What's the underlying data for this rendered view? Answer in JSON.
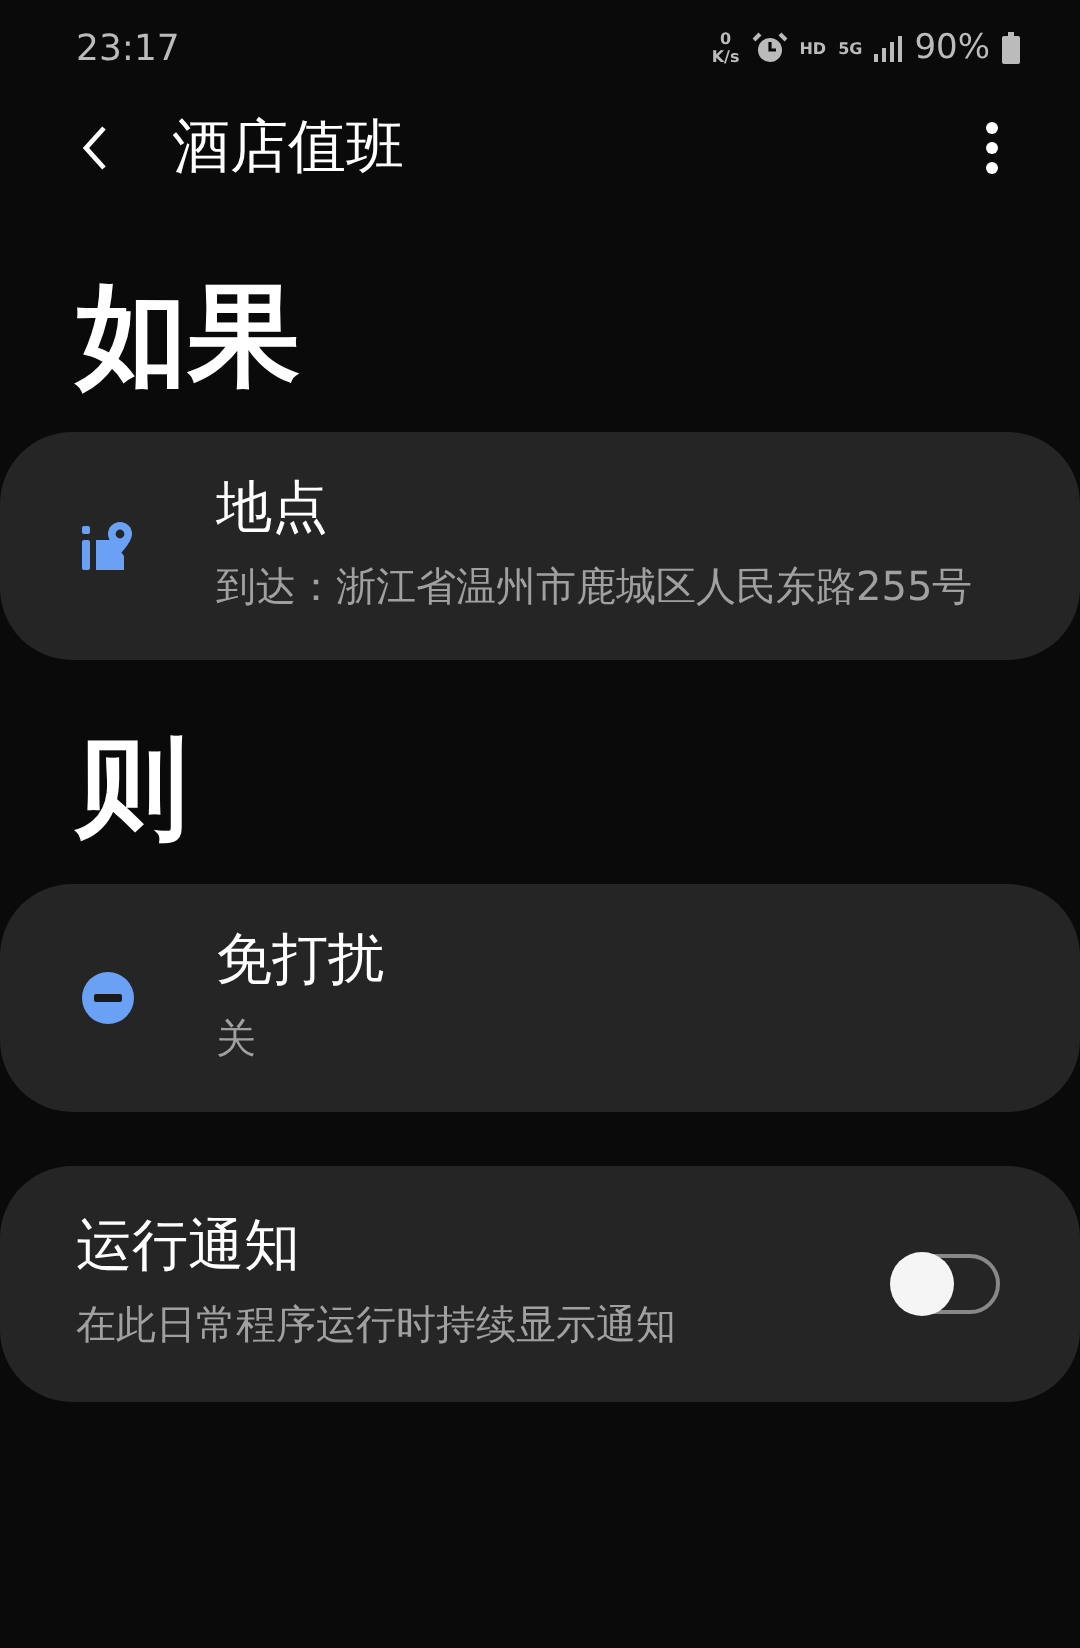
{
  "status_bar": {
    "time": "23:17",
    "speed_value": "0",
    "speed_unit": "K/s",
    "hd": "HD",
    "network": "5G",
    "battery": "90%"
  },
  "header": {
    "title": "酒店值班"
  },
  "sections": [
    {
      "heading": "如果",
      "cards": [
        {
          "kind": "location",
          "title": "地点",
          "subtitle": "到达：浙江省温州市鹿城区人民东路255号"
        }
      ]
    },
    {
      "heading": "则",
      "cards": [
        {
          "kind": "dnd",
          "title": "免打扰",
          "subtitle": "关"
        }
      ]
    }
  ],
  "notification": {
    "title": "运行通知",
    "description": "在此日常程序运行时持续显示通知",
    "on": false
  }
}
